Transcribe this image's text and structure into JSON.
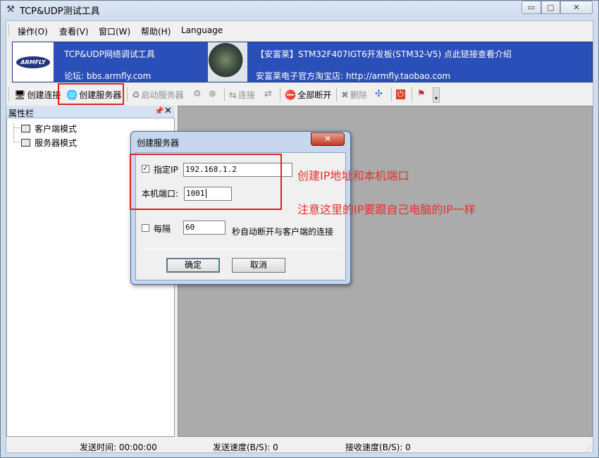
{
  "window": {
    "title": "TCP&UDP测试工具",
    "controls": {
      "minimize": "▭",
      "maximize": "▢",
      "close": "✕"
    }
  },
  "menu": {
    "items": [
      "操作(O)",
      "查看(V)",
      "窗口(W)",
      "帮助(H)",
      "Language"
    ]
  },
  "banner": {
    "logo_text": "ARMFLY",
    "app_name": "TCP&UDP网络调试工具",
    "forum": "论坛: bbs.armfly.com",
    "promo": "【安富莱】STM32F407IGT6开发板(STM32-V5) 点此链接查看介绍",
    "shop": "安富莱电子官方淘宝店: http://armfly.taobao.com"
  },
  "toolbar": {
    "create_connection": "创建连接",
    "create_server": "创建服务器",
    "start_server": "启动服务器",
    "connect": "连接",
    "disconnect_all": "全部断开",
    "delete": "删除"
  },
  "sidebar": {
    "title": "属性栏",
    "items": [
      "客户端模式",
      "服务器模式"
    ]
  },
  "dialog": {
    "title": "创建服务器",
    "specify_ip_label": "指定IP",
    "specify_ip_checked": true,
    "ip_value": "192.168.1.2",
    "port_label": "本机端口:",
    "port_value": "1001",
    "every_label": "每隔",
    "every_checked": false,
    "every_value": "60",
    "every_suffix": "秒自动断开与客户端的连接",
    "ok_label": "确定",
    "cancel_label": "取消"
  },
  "annotations": {
    "note1": "创建IP地址和本机端口",
    "note2": "注意这里的IP要跟自己电脑的IP一样"
  },
  "statusbar": {
    "send_time": "发送时间: 00:00:00",
    "send_speed": "发送速度(B/S): 0",
    "recv_speed": "接收速度(B/S): 0"
  },
  "colors": {
    "banner_bg": "#2b4fb8",
    "highlight_red": "#e02020",
    "annotation_red": "#e83030",
    "workarea_gray": "#ababab"
  }
}
